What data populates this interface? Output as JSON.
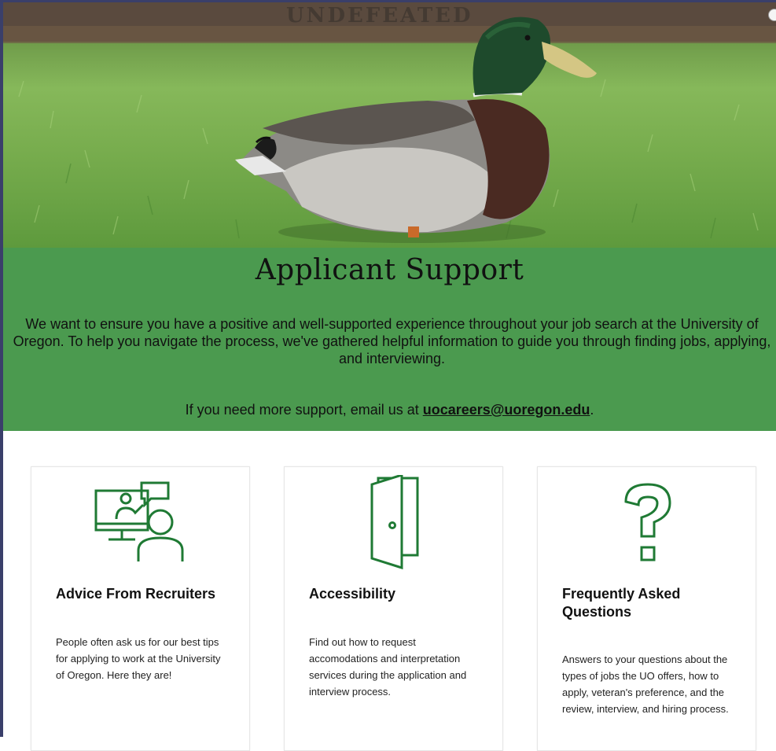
{
  "hero": {
    "wordmark": "UNDEFEATED",
    "image_alt": "Mallard duck standing on green grass"
  },
  "band": {
    "title": "Applicant Support",
    "intro": "We want to ensure you have a positive and well-supported experience throughout your job search at the University of Oregon. To help you navigate the process, we've gathered helpful information to guide you through finding jobs, applying, and interviewing.",
    "contact_prefix": "If you need more support, email us at ",
    "contact_email": "uocareers@uoregon.edu",
    "contact_suffix": "."
  },
  "cards": [
    {
      "title": "Advice From Recruiters",
      "body": "People often ask us for our best tips for applying to work at the University of Oregon. Here they are!",
      "icon": "presentation-chat-icon"
    },
    {
      "title": "Accessibility",
      "body": "Find out how to request accomodations and interpretation services during the application and interview process.",
      "icon": "open-door-icon"
    },
    {
      "title": "Frequently Asked Questions",
      "body": "Answers to your questions about the types of jobs the UO offers, how to apply, veteran's preference, and the review, interview, and hiring process.",
      "icon": "question-mark-icon"
    }
  ],
  "colors": {
    "band_green": "#4b9a4f",
    "icon_green": "#1f7a34",
    "frame": "#3a3f6a"
  }
}
